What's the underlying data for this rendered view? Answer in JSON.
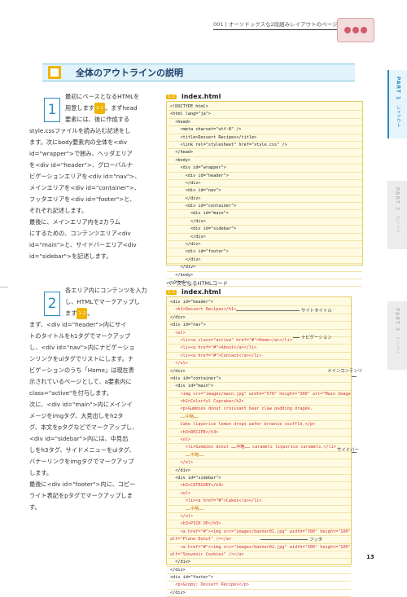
{
  "header": {
    "chapter_text": "001 | オーソドックスな2段組みレイアウトのページ"
  },
  "section": {
    "title": "全体のアウトラインの説明"
  },
  "side_tabs": [
    {
      "label": "PART 1",
      "sub": "レイアウト"
    },
    {
      "label": "PART 2",
      "sub": "グリッド"
    },
    {
      "label": "PART 3",
      "sub": "アシスト"
    }
  ],
  "step1": {
    "number": "1",
    "lines": [
      "最初にベースとなるHTMLを",
      "用意します[1-1]。まずhead",
      "要素には、後に作成する",
      "style.cssファイルを読み込む記述をし",
      "ます。次にbody要素内の全体を<div",
      "id=\"wrapper\">で囲み、ヘッダエリア",
      "を<div id=\"header\">、グローバルナ",
      "ビゲーションエリアを<div id=\"nav\">、",
      "メインエリアを<div id=\"container\">、",
      "フッタエリアを<div id=\"footer\">と、",
      "それぞれ記述します。",
      "最後に、メインエリア内を2カラム",
      "にするための、コンテンツエリア<div",
      "id=\"main\">と、サイドバーエリア<div",
      "id=\"sidebar\">を記述します。"
    ],
    "badge": "1-1"
  },
  "code1": {
    "badge": "1-1",
    "title": "index.html",
    "lines": [
      "<!DOCTYPE html>",
      "<html lang=\"ja\">",
      "  <head>",
      "    <meta charset=\"utf-8\" />",
      "    <title>Dessert Recipes</title>",
      "    <link rel=\"stylesheet\" href=\"style.css\" />",
      "  </head>",
      "  <body>",
      "    <div id=\"wrapper\">",
      "      <div id=\"header\">",
      "      </div>",
      "      <div id=\"nav\">",
      "      </div>",
      "      <div id=\"container\">",
      "        <div id=\"main\">",
      "        </div>",
      "        <div id=\"sidebar\">",
      "        </div>",
      "      </div>",
      "      <div id=\"footer\">",
      "      </div>",
      "    </div>",
      "  </body>",
      "</html>"
    ],
    "caption": "ベースとなるHTMLコード"
  },
  "step2": {
    "number": "2",
    "lines": [
      "各エリア内にコンテンツを入力",
      "し、HTMLでマークアップし",
      "ます[1-2]。",
      "まず、<div id=\"header\">内にサイ",
      "トのタイトルをh1タグでマークアップ",
      "し、<div id=\"nav\">内にナビゲーショ",
      "ンリンクをulタグでリストにします。ナ",
      "ビゲーションのうち「Home」は現在表",
      "示されているページとして、a要素内に",
      "class=\"active\"を付与します。",
      "次に、<div id=\"main\">内にメインイ",
      "メージをimgタグ、大見出しをh2タ",
      "グ、本文をpタグなどでマークアップし、",
      "<div id=\"sidebar\">内には、中見出",
      "しをh3タグ、サイドメニューをulタグ、",
      "バナーリンクをimgタグでマークアップ",
      "します。",
      "最後に<div id=\"footer\">内に、コピー",
      "ライト表記をpタグでマークアップしま",
      "す。"
    ],
    "badge": "1-2"
  },
  "code2": {
    "badge": "1-2",
    "title": "index.html",
    "lines": [
      {
        "t": "<div id=\"header\">",
        "c": ""
      },
      {
        "t": "  <h1>Dessert Recipes</h1>",
        "c": "red"
      },
      {
        "t": "</div>",
        "c": ""
      },
      {
        "t": "<div id=\"nav\">",
        "c": ""
      },
      {
        "t": "  <ul>",
        "c": "red"
      },
      {
        "t": "    <li><a class=\"active\" href=\"#\">Home</a></li>",
        "c": "red"
      },
      {
        "t": "    <li><a href=\"#\">About</a></li>",
        "c": "red"
      },
      {
        "t": "    <li><a href=\"#\">Contact</a></li>",
        "c": "red"
      },
      {
        "t": "  </ul>",
        "c": "red"
      },
      {
        "t": "</div>",
        "c": ""
      },
      {
        "t": "<div id=\"container\">",
        "c": ""
      },
      {
        "t": "  <div id=\"main\">",
        "c": ""
      },
      {
        "t": "    <img src=\"images/main.jpg\" width=\"570\" height=\"300\" alt=\"Main Image\" />",
        "c": "red"
      },
      {
        "t": "    <h2>Colorful Cupcake</h2>",
        "c": "red"
      },
      {
        "t": "    <p>Gummies donut croissant bear claw pudding dragée.",
        "c": "red"
      },
      {
        "t": "    ……中略……",
        "c": "orange"
      },
      {
        "t": "    Cake liquorice lemon drops wafer brownie soufflé.</p>",
        "c": "red"
      },
      {
        "t": "    <h3>RECIPE</h3>",
        "c": "red"
      },
      {
        "t": "    <ol>",
        "c": "red"
      },
      {
        "t": "      <li>Gummies donut ……中略…… caramels liquorice caramels.</li>",
        "c": "red"
      },
      {
        "t": "      ……中略……",
        "c": "orange"
      },
      {
        "t": "    </ol>",
        "c": "red"
      },
      {
        "t": "  </div>",
        "c": ""
      },
      {
        "t": "  <div id=\"sidebar\">",
        "c": ""
      },
      {
        "t": "    <h3>CATEGORY</h3>",
        "c": "red"
      },
      {
        "t": "    <ul>",
        "c": "red"
      },
      {
        "t": "      <li><a href=\"#\">Cakes</a></li>",
        "c": "red"
      },
      {
        "t": "      ……中略……",
        "c": "orange"
      },
      {
        "t": "    </ul>",
        "c": "red"
      },
      {
        "t": "    <h3>PICK UP</h3>",
        "c": "red"
      },
      {
        "t": "    <a href=\"#\"><img src=\"images/banner01.jpg\" width=\"300\" height=\"100\"",
        "c": "red"
      },
      {
        "t": "alt=\"Plane Donut\" /></a>",
        "c": "red"
      },
      {
        "t": "    <a href=\"#\"><img src=\"images/banner02.jpg\" width=\"300\" height=\"100\"",
        "c": "red"
      },
      {
        "t": "alt=\"Souvenir Cookies\" /></a>",
        "c": "red"
      },
      {
        "t": "  </div>",
        "c": ""
      },
      {
        "t": "</div>",
        "c": ""
      },
      {
        "t": "<div id=\"footer\">",
        "c": ""
      },
      {
        "t": "  <p>&copy; Dessert Recipes</p>",
        "c": "red"
      },
      {
        "t": "</div>",
        "c": ""
      }
    ],
    "annotations": [
      "サイトタイトル",
      "ナビゲーション",
      "メインコンテンツ",
      "サイドバー",
      "フッタ"
    ]
  },
  "page_number": "13"
}
